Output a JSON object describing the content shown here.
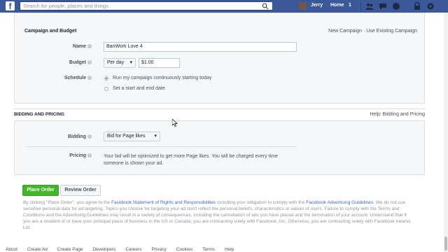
{
  "nav": {
    "search_placeholder": "Search for people, places and things",
    "user_name": "Jerry",
    "home_label": "Home",
    "home_count": "1"
  },
  "campaign": {
    "title": "Campaign and Budget",
    "new_campaign": "New Campaign",
    "separator": " · ",
    "existing_campaign": "Use Existing Campaign",
    "name_label": "Name",
    "name_value": "BanWork Love 4",
    "budget_label": "Budget",
    "budget_type": "Per day",
    "budget_value": "$1.00",
    "schedule_label": "Schedule",
    "schedule_option1": "Run my campaign continuously starting today",
    "schedule_option2": "Set a start and end date"
  },
  "bidding": {
    "title": "BIDDING AND PRICING",
    "help_link": "Help: Bidding and Pricing",
    "bidding_label": "Bidding",
    "bidding_value": "Bid for Page likes",
    "pricing_label": "Pricing",
    "pricing_text": "Your bid will be optimized to get more Page likes. You will be charged every time someone is shown your ad."
  },
  "actions": {
    "place_order": "Place Order",
    "review_order": "Review Order"
  },
  "legal": {
    "part1": "By clicking \"Place Order\", you agree to the ",
    "link1": "Facebook Statement of Rights and Responsibilities",
    "part2": " including your obligation to comply with the ",
    "link2": "Facebook Advertising Guidelines",
    "part3": ". We do not use sensitive personal data for ad targeting. Topics you choose for targeting your ad don't reflect the personal beliefs, characteristics or values of users. Failure to comply with the Terms and Conditions and the Advertising Guidelines may result in a variety of consequences, including the cancellation of ads you have placed and the termination of your account. Understand that if you are a resident of or have your principal place of business in the US or Canada, you are contracting solely with Facebook, Inc. Otherwise, you are contracting solely with Facebook Ireland, Ltd."
  },
  "footer": [
    "About",
    "Create Ad",
    "Create Page",
    "Developers",
    "Careers",
    "Privacy",
    "Cookies",
    "Terms",
    "Help"
  ],
  "colors": {
    "brand": "#3b5998",
    "link": "#4267b2",
    "green": "#42b72a"
  }
}
